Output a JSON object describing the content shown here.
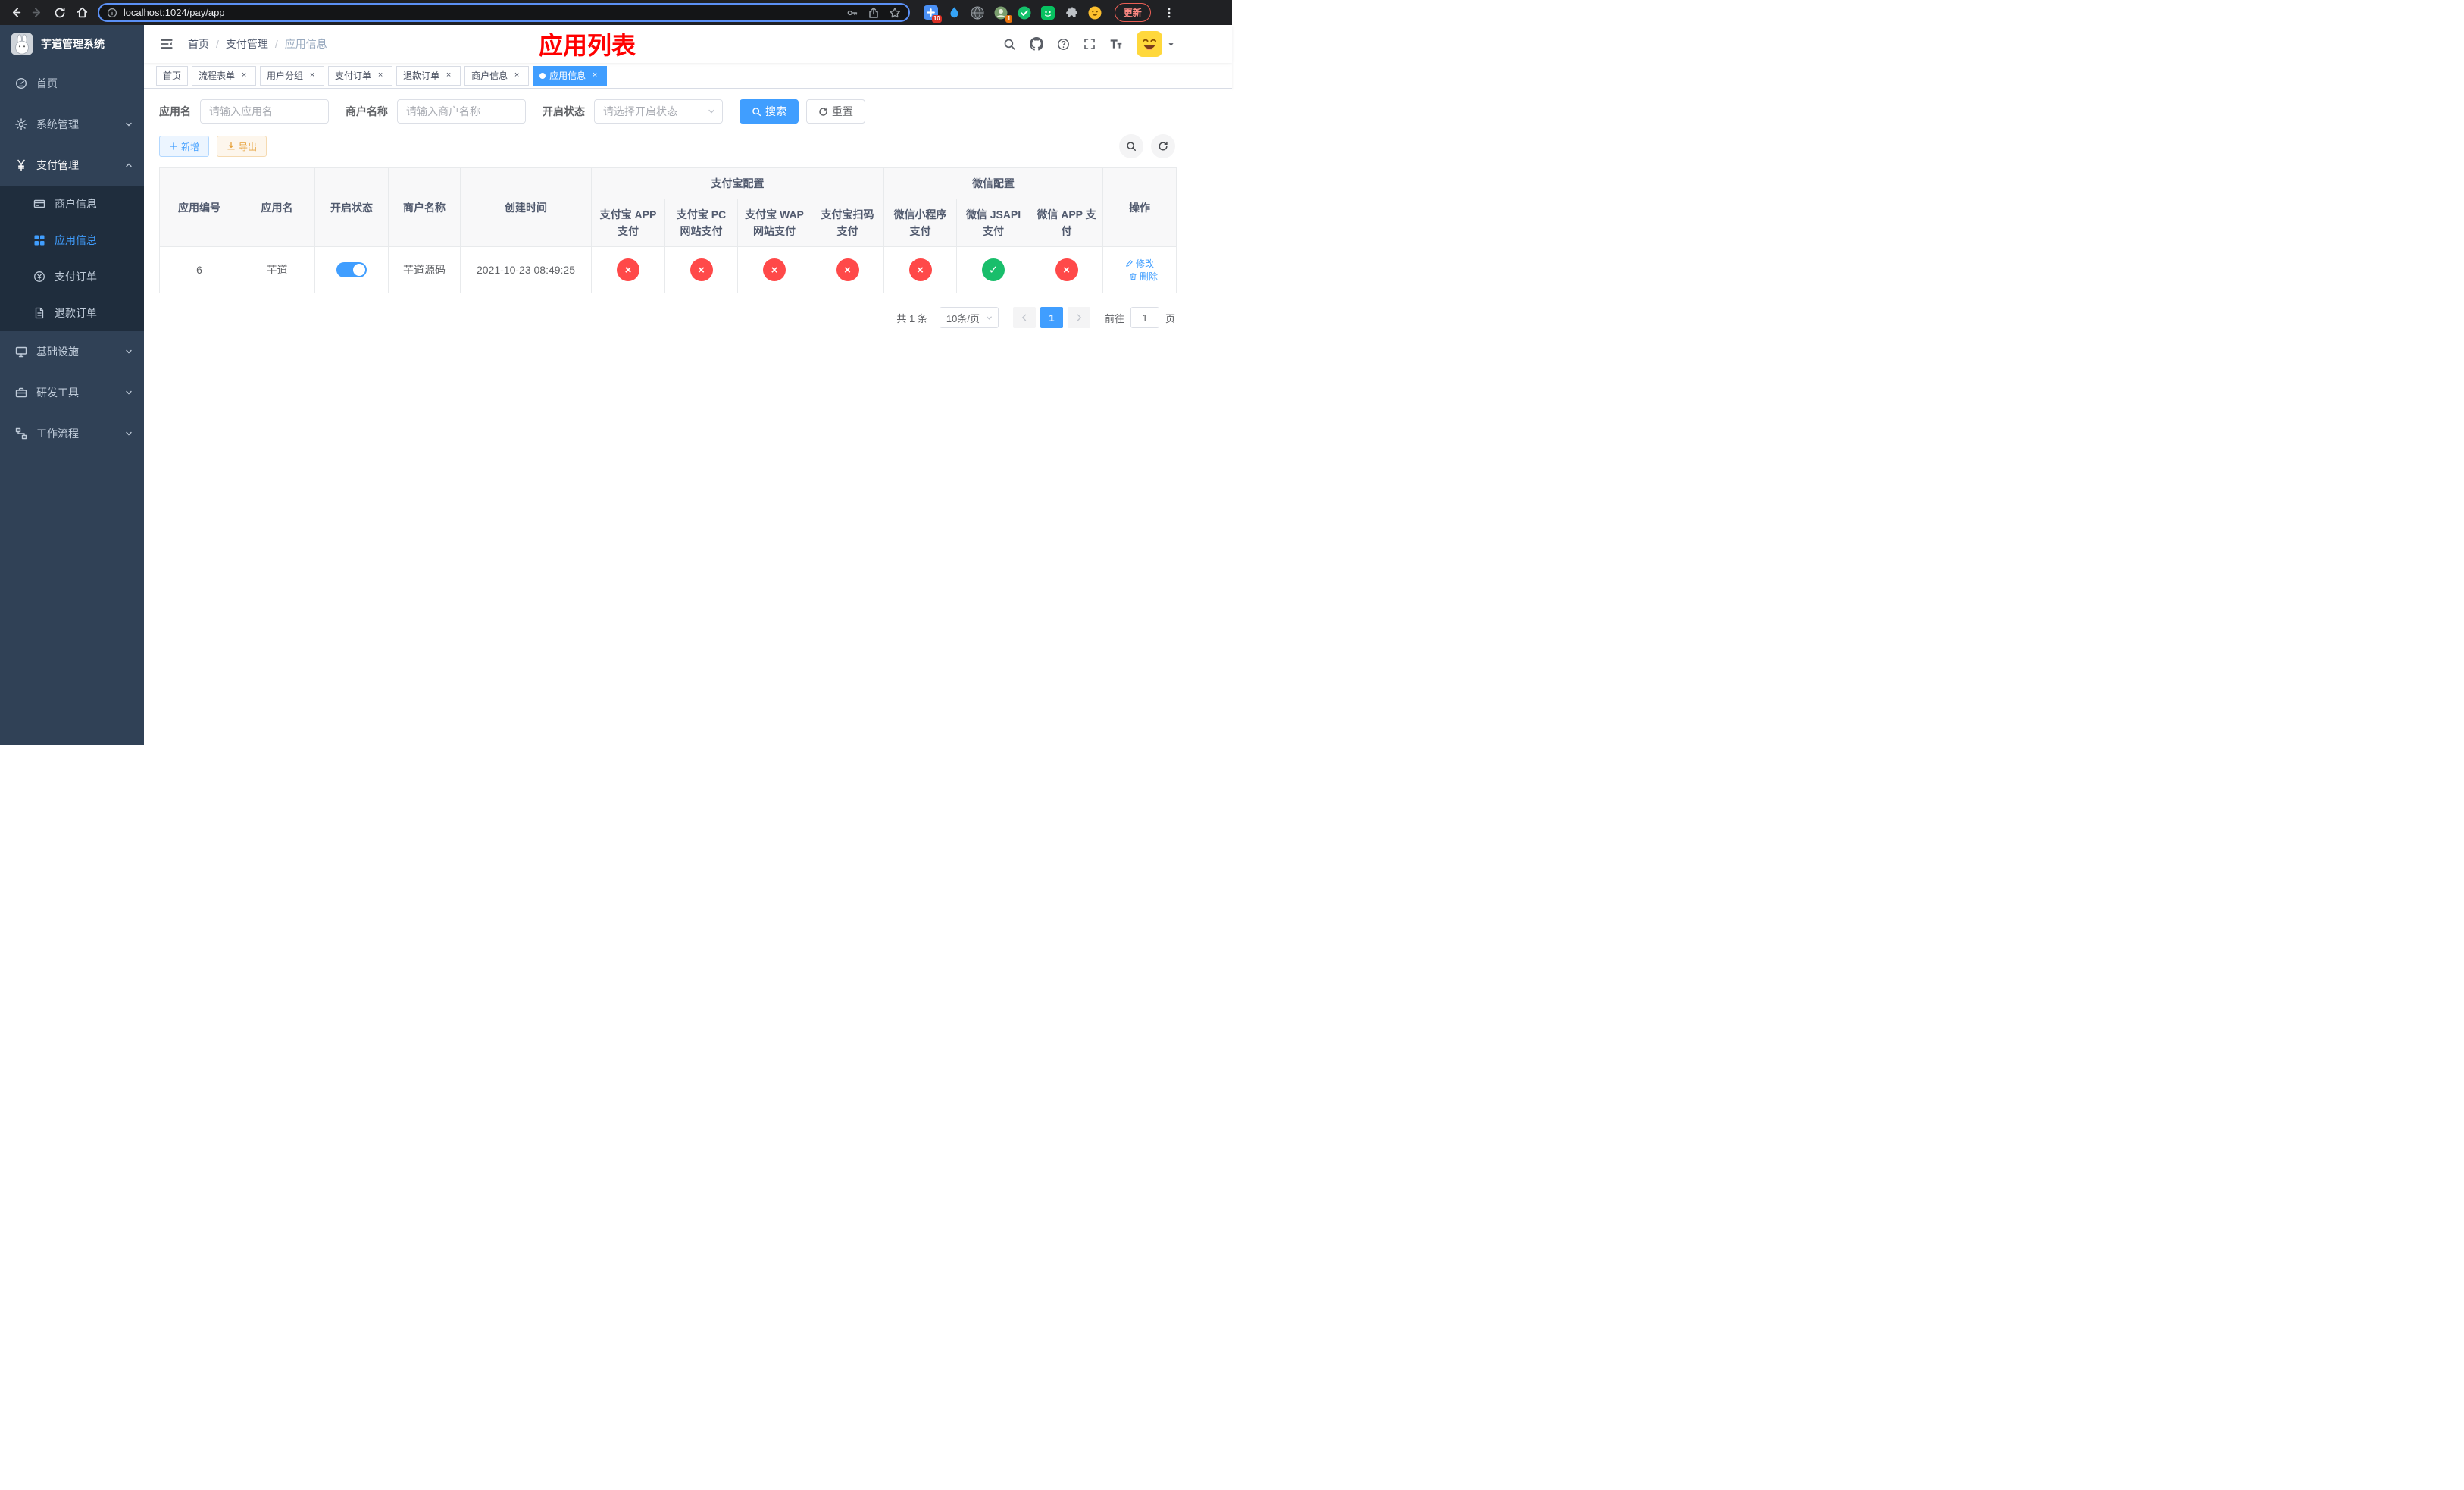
{
  "colors": {
    "primary": "#409eff",
    "success": "#19be6b",
    "danger": "#ff4949",
    "warning": "#e6a23c",
    "banner_title": "#ff0000",
    "sidebar_bg": "#304156",
    "submenu_bg": "#1f2d3d"
  },
  "browser": {
    "url": "localhost:1024/pay/app",
    "update_label": "更新",
    "extension_badge_adblock": "10",
    "extension_badge_avatar": "1"
  },
  "sidebar": {
    "title": "芋道管理系统",
    "menu": [
      {
        "label": "首页"
      },
      {
        "label": "系统管理"
      },
      {
        "label": "支付管理"
      },
      {
        "label": "基础设施"
      },
      {
        "label": "研发工具"
      },
      {
        "label": "工作流程"
      }
    ],
    "payment_submenu": [
      {
        "label": "商户信息"
      },
      {
        "label": "应用信息",
        "active": true
      },
      {
        "label": "支付订单"
      },
      {
        "label": "退款订单"
      }
    ]
  },
  "header": {
    "breadcrumb": [
      "首页",
      "支付管理",
      "应用信息"
    ],
    "banner_title": "应用列表"
  },
  "tabs": [
    {
      "label": "首页",
      "closable": false
    },
    {
      "label": "流程表单",
      "closable": true
    },
    {
      "label": "用户分组",
      "closable": true
    },
    {
      "label": "支付订单",
      "closable": true
    },
    {
      "label": "退款订单",
      "closable": true
    },
    {
      "label": "商户信息",
      "closable": true
    },
    {
      "label": "应用信息",
      "closable": true,
      "active": true
    }
  ],
  "filters": {
    "app_name_label": "应用名",
    "app_name_placeholder": "请输入应用名",
    "merchant_name_label": "商户名称",
    "merchant_name_placeholder": "请输入商户名称",
    "status_label": "开启状态",
    "status_placeholder": "请选择开启状态",
    "search_button": "搜索",
    "reset_button": "重置"
  },
  "toolbar": {
    "add_button": "新增",
    "export_button": "导出"
  },
  "table": {
    "columns": {
      "id": "应用编号",
      "name": "应用名",
      "status": "开启状态",
      "merchant": "商户名称",
      "created": "创建时间",
      "alipay_group": "支付宝配置",
      "wechat_group": "微信配置",
      "ops": "操作",
      "alipay_app": "支付宝 APP 支付",
      "alipay_pc": "支付宝 PC 网站支付",
      "alipay_wap": "支付宝 WAP 网站支付",
      "alipay_qr": "支付宝扫码支付",
      "wechat_mini": "微信小程序支付",
      "wechat_jsapi": "微信 JSAPI 支付",
      "wechat_app": "微信 APP 支付"
    },
    "rows": [
      {
        "id": "6",
        "name": "芋道",
        "enabled": true,
        "merchant": "芋道源码",
        "created": "2021-10-23 08:49:25",
        "configs": [
          false,
          false,
          false,
          false,
          false,
          true,
          false
        ],
        "edit_label": "修改",
        "delete_label": "删除"
      }
    ]
  },
  "pagination": {
    "total_text": "共 1 条",
    "page_size": "10条/页",
    "current_page": "1",
    "goto_label": "前往",
    "goto_value": "1",
    "page_unit": "页"
  }
}
